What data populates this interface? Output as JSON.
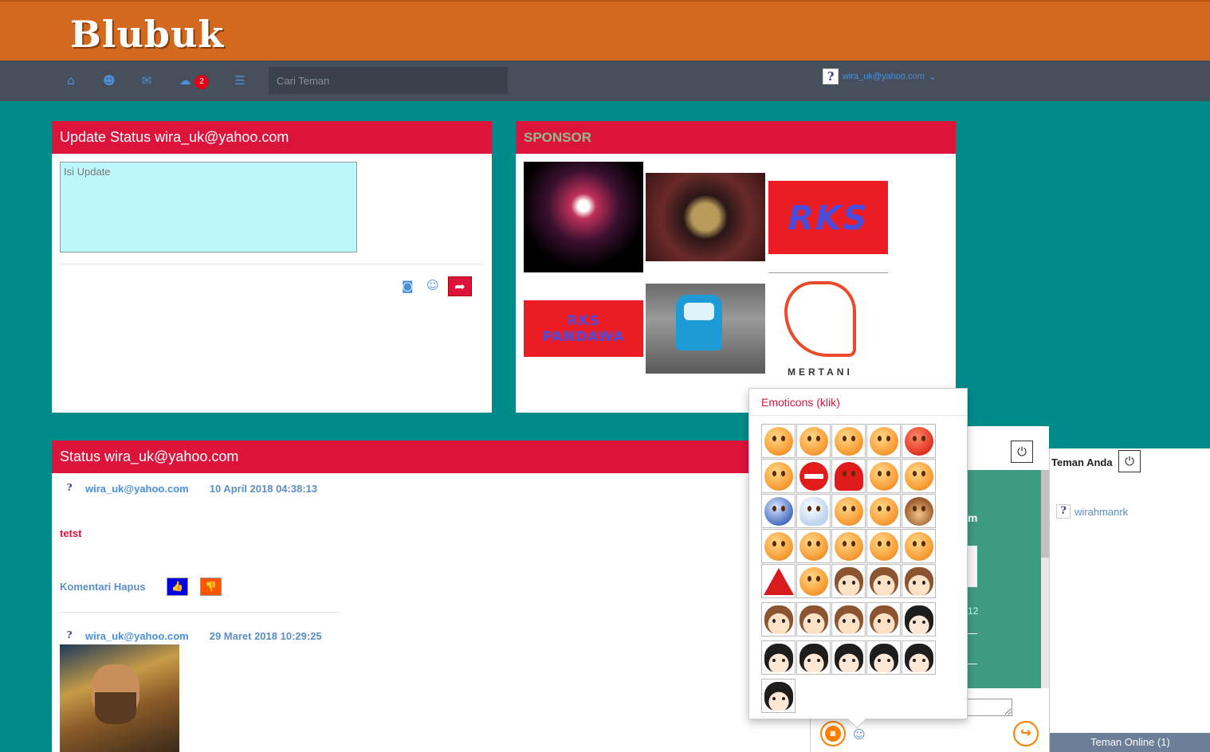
{
  "app": {
    "logo": "Blubuk"
  },
  "navbar": {
    "icons": [
      "home-icon",
      "users-icon",
      "mail-icon",
      "comments-icon",
      "book-icon"
    ],
    "glyphs": {
      "home": "⌂",
      "users": "☻",
      "mail": "✉",
      "comments": "☁",
      "book": "☰"
    },
    "notification_count": "2",
    "search_placeholder": "Cari Teman",
    "user": {
      "avatar": "?",
      "email": "wira_uk@yahoo.com",
      "caret": "⌄"
    }
  },
  "status_update": {
    "title": "Update Status wira_uk@yahoo.com",
    "textarea_placeholder": "Isi Update",
    "camera_glyph": "◙",
    "smile_glyph": "☺",
    "share_glyph": "➦"
  },
  "sponsor": {
    "title": "SPONSOR",
    "items": [
      {
        "text": ""
      },
      {
        "text": ""
      },
      {
        "text": "RKS"
      },
      {
        "line1": "RKS",
        "line2": "PANDAWA"
      },
      {
        "text": ""
      },
      {
        "text": "MERTANI"
      }
    ]
  },
  "status_list": {
    "title": "Status wira_uk@yahoo.com",
    "posts": [
      {
        "avatar": "?",
        "author": "wira_uk@yahoo.com",
        "date": "10 April 2018 04:38:13",
        "text": "tetst",
        "actions": "Komentari Hapus",
        "like": "👍",
        "dislike": "👎"
      },
      {
        "avatar": "?",
        "author": "wira_uk@yahoo.com",
        "date": "29 Maret 2018 10:29:25"
      }
    ]
  },
  "chat": {
    "power_glyph": "⏻",
    "partial_letter": "m",
    "partial_number": "12",
    "camera_glyph": "◙",
    "smile_glyph": "☺",
    "send_glyph": "↪"
  },
  "friends": {
    "title": "Teman Anda",
    "power_glyph": "⏻",
    "list": [
      {
        "avatar": "?",
        "name": "wirahmanrk"
      }
    ],
    "footer": "Teman Online (1)"
  },
  "emoticons": {
    "title": "Emoticons (klik)",
    "items": [
      "angel-emoticon",
      "confused-emoticon",
      "cool-emoticon",
      "crying-emoticon",
      "devil-emoticon",
      "nerd-emoticon",
      "stop-emoticon",
      "heart-emoticon",
      "glasses-emoticon",
      "grin-emoticon",
      "question-emoticon",
      "idea-emoticon",
      "exclamation-emoticon",
      "kiss-emoticon",
      "monkey-emoticon",
      "tongue-emoticon",
      "sad-emoticon",
      "laugh-emoticon",
      "smile-emoticon",
      "surprised-emoticon",
      "warning-emoticon",
      "wink-emoticon",
      "kid-angry-emoticon",
      "kid-shocked-emoticon",
      "kid-laugh-emoticon",
      "kid-shout-emoticon",
      "kid-scream-emoticon",
      "kid-cry-emoticon",
      "kid-wipe-emoticon",
      "girl-bye-emoticon",
      "girl-cry-emoticon",
      "girl-blush-emoticon",
      "girl-sad-emoticon",
      "girl-tear-emoticon",
      "girl-shock-emoticon",
      "girl-smile-emoticon"
    ]
  },
  "colors": {
    "header": "#d2691e",
    "navbar": "#474f5c",
    "background": "#008b8b",
    "accent": "#dc143c",
    "link": "#4a90d9"
  }
}
